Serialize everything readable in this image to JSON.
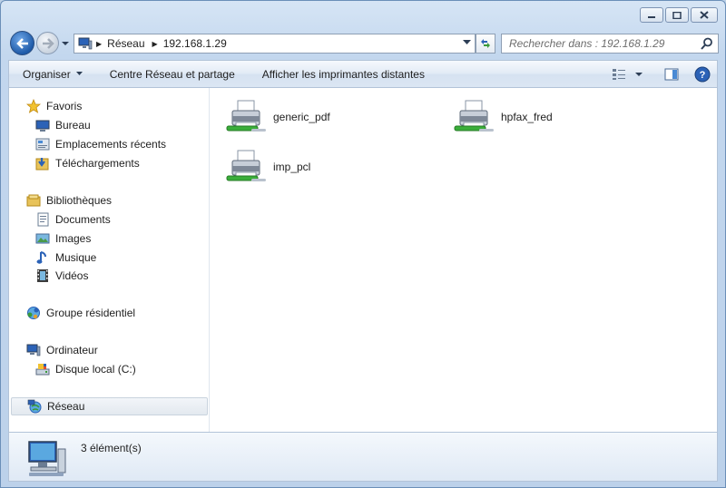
{
  "window": {
    "controls": [
      "minimize-icon",
      "maximize-icon",
      "close-icon"
    ]
  },
  "address_bar": {
    "segments": [
      "Réseau",
      "192.168.1.29"
    ]
  },
  "search": {
    "placeholder": "Rechercher dans : 192.168.1.29"
  },
  "toolbar": {
    "organize_label": "Organiser",
    "network_center_label": "Centre Réseau et partage",
    "remote_printers_label": "Afficher les imprimantes distantes"
  },
  "nav": {
    "favorites": {
      "label": "Favoris",
      "items": [
        {
          "label": "Bureau",
          "icon": "desktop-icon"
        },
        {
          "label": "Emplacements récents",
          "icon": "recent-places-icon"
        },
        {
          "label": "Téléchargements",
          "icon": "downloads-icon"
        }
      ]
    },
    "libraries": {
      "label": "Bibliothèques",
      "items": [
        {
          "label": "Documents",
          "icon": "documents-icon"
        },
        {
          "label": "Images",
          "icon": "pictures-icon"
        },
        {
          "label": "Musique",
          "icon": "music-icon"
        },
        {
          "label": "Vidéos",
          "icon": "videos-icon"
        }
      ]
    },
    "homegroup": {
      "label": "Groupe résidentiel"
    },
    "computer": {
      "label": "Ordinateur",
      "items": [
        {
          "label": "Disque local (C:)",
          "icon": "local-disk-icon"
        }
      ]
    },
    "network": {
      "label": "Réseau",
      "selected": true
    }
  },
  "files": [
    {
      "name": "generic_pdf",
      "icon": "network-printer-icon"
    },
    {
      "name": "hpfax_fred",
      "icon": "network-printer-icon"
    },
    {
      "name": "imp_pcl",
      "icon": "network-printer-icon"
    }
  ],
  "details": {
    "count_label": "3 élément(s)"
  },
  "colors": {
    "frame": "#bcd0e6",
    "selection": "#e3e9ef",
    "accent": "#1e5aa8"
  }
}
